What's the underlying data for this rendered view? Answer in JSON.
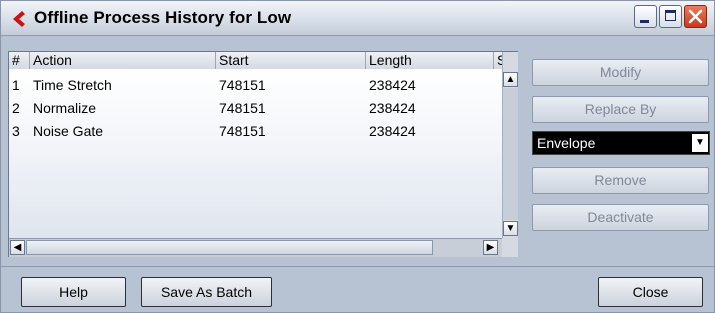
{
  "window": {
    "title": "Offline Process History for Low"
  },
  "table": {
    "columns": [
      "#",
      "Action",
      "Start",
      "Length",
      "Sta"
    ],
    "rows": [
      {
        "num": "1",
        "action": "Time Stretch",
        "start": "748151",
        "length": "238424"
      },
      {
        "num": "2",
        "action": "Normalize",
        "start": "748151",
        "length": "238424"
      },
      {
        "num": "3",
        "action": "Noise Gate",
        "start": "748151",
        "length": "238424"
      }
    ]
  },
  "side": {
    "modify_label": "Modify",
    "replace_label": "Replace By",
    "dropdown_value": "Envelope",
    "remove_label": "Remove",
    "deactivate_label": "Deactivate"
  },
  "footer": {
    "help_label": "Help",
    "save_batch_label": "Save As Batch",
    "close_label": "Close"
  },
  "colors": {
    "window_bg": "#b7c3d3",
    "close_button": "#d9482a",
    "app_icon": "#cc1111"
  }
}
